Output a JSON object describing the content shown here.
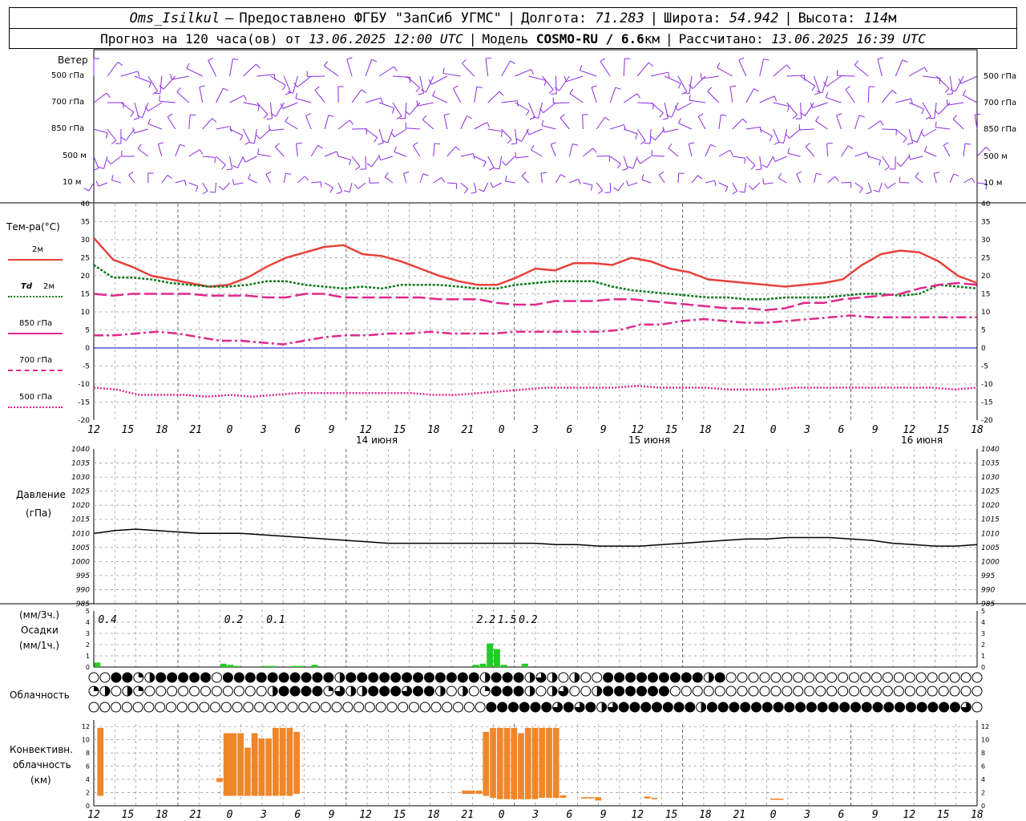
{
  "header": {
    "station": "Oms_Isilkul",
    "dash": "–",
    "provider": "Предоставлено ФГБУ \"ЗапСиб УГМС\"",
    "lon_label": "Долгота:",
    "lon_value": "71.283",
    "lat_label": "Широта:",
    "lat_value": "54.942",
    "alt_label": "Высота:",
    "alt_value": "114",
    "alt_unit": "м",
    "forecast_prefix": "Прогноз на 120 часа(ов) от",
    "forecast_time": "13.06.2025 12:00 UTC",
    "model_label": "Модель",
    "model_name": "COSMO-RU / 6.6",
    "model_unit": "км",
    "calc_label": "Рассчитано:",
    "calc_time": "13.06.2025 16:39 UTC"
  },
  "labels": {
    "wind_title": "Ветер",
    "wind_levels": [
      "500 гПа",
      "700 гПа",
      "850 гПа",
      "500 м",
      "10  м"
    ],
    "temp_title": "Тем-ра(°С)",
    "legend_2m": "2м",
    "legend_td": "Td",
    "legend_td_2m": "2м",
    "legend_850": "850 гПа",
    "legend_700": "700 гПа",
    "legend_500": "500 гПа",
    "pressure_title": "Давление",
    "pressure_unit": "(гПа)",
    "precip_unit3": "(мм/3ч.)",
    "precip_title": "Осадки",
    "precip_unit1": "(мм/1ч.)",
    "cloud_title": "Облачность",
    "conv_title1": "Конвективн.",
    "conv_title2": "облачность",
    "conv_unit": "(км)",
    "day_labels": [
      "14 июня",
      "15 июня",
      "16 июня"
    ]
  },
  "colors": {
    "wind": "#8a2be2",
    "t2m": "#e8413c",
    "td": "#0a7a1a",
    "t850": "#e0288c",
    "zero": "#0000cc",
    "pressure": "#000000",
    "precip": "#22cc22",
    "conv": "#f0862a",
    "grid": "#999999"
  },
  "chart_data": [
    {
      "type": "line",
      "name": "temperature",
      "x_hours": [
        0,
        3,
        6,
        9,
        12,
        15,
        18,
        21,
        24,
        27,
        30,
        33,
        36,
        39,
        42,
        45,
        48,
        51,
        54,
        57,
        60,
        63,
        66,
        69,
        72,
        75,
        78,
        81,
        84,
        87,
        90,
        93,
        96,
        99,
        102,
        105,
        108,
        111,
        114,
        117,
        120,
        123,
        126
      ],
      "x_tick_labels": [
        "12",
        "15",
        "18",
        "21",
        "0",
        "3",
        "6",
        "9",
        "12",
        "15",
        "18",
        "21",
        "0",
        "3",
        "6",
        "9",
        "12",
        "15",
        "18",
        "21",
        "0",
        "3",
        "6",
        "9",
        "12",
        "15",
        "18"
      ],
      "ylim": [
        -20,
        40
      ],
      "y_ticks": [
        -20,
        -15,
        -10,
        -5,
        0,
        5,
        10,
        15,
        20,
        25,
        30,
        35,
        40
      ],
      "series": [
        {
          "name": "2м",
          "key": "t2m",
          "values": [
            30.5,
            24.5,
            22.5,
            20,
            19,
            18,
            17,
            17.5,
            19.5,
            22.5,
            25,
            26.5,
            28,
            28.5,
            26,
            25.5,
            24,
            22,
            20,
            18.5,
            17.5,
            17.5,
            19.5,
            22,
            21.5,
            23.5,
            23.5,
            23,
            25,
            24,
            22,
            21,
            19,
            18.5,
            18,
            17.5,
            17,
            17.5,
            18,
            19,
            23,
            26,
            27,
            26.5,
            24,
            20,
            18
          ]
        },
        {
          "name": "Td 2м",
          "key": "td",
          "values": [
            23,
            19.5,
            19.5,
            19,
            18,
            17.5,
            17,
            17,
            17.5,
            18.5,
            18.5,
            17.5,
            17,
            16.5,
            17,
            16.5,
            17.5,
            17.5,
            17.5,
            17,
            16.5,
            16.5,
            17.5,
            18,
            18.5,
            18.5,
            18.5,
            17,
            16,
            15.5,
            15,
            14.5,
            14,
            14,
            13.5,
            13.5,
            14,
            14,
            14,
            14.5,
            15,
            15,
            14.5,
            15,
            17.5,
            17,
            16.5
          ]
        },
        {
          "name": "850 гПа",
          "key": "t850",
          "values": [
            15,
            14.5,
            15,
            15,
            15,
            15,
            14.5,
            14.5,
            14.5,
            14,
            14,
            15,
            15,
            14,
            14,
            14,
            14,
            14,
            13.5,
            13.5,
            13.5,
            12.5,
            12,
            12,
            13,
            13,
            13,
            13.5,
            13.5,
            13,
            12.5,
            12,
            11.5,
            11,
            11,
            10.5,
            11,
            12.5,
            12.5,
            13.5,
            14,
            14.5,
            15,
            16.5,
            17.5,
            18,
            17.5
          ]
        },
        {
          "name": "700 гПа",
          "key": "t700",
          "values": [
            3.5,
            3.5,
            4,
            4.5,
            4,
            3,
            2,
            2,
            1.5,
            1,
            2,
            3,
            3.5,
            3.5,
            4,
            4,
            4.5,
            4,
            4,
            4,
            4.5,
            4.5,
            4.5,
            4.5,
            4.5,
            5,
            6.5,
            6.5,
            7.5,
            8,
            7.5,
            7,
            7,
            7.5,
            8,
            8.5,
            9,
            8.5,
            8.5,
            8.5,
            8.5,
            8.5,
            8.5
          ]
        },
        {
          "name": "500 гПа",
          "key": "t500",
          "values": [
            -11,
            -11.5,
            -13,
            -13,
            -13,
            -13.5,
            -13,
            -13.5,
            -13,
            -12.5,
            -12.5,
            -12.5,
            -12.5,
            -12.5,
            -12.5,
            -13,
            -13,
            -12.5,
            -12,
            -11.5,
            -11,
            -11,
            -11,
            -11,
            -10.5,
            -11,
            -11,
            -11,
            -11.5,
            -11.5,
            -11.5,
            -11,
            -11,
            -11,
            -11,
            -11,
            -11,
            -11,
            -11.5,
            -11
          ]
        }
      ]
    },
    {
      "type": "line",
      "name": "pressure",
      "title": "Давление",
      "ylabel": "(гПа)",
      "ylim": [
        985,
        1040
      ],
      "y_ticks": [
        985,
        990,
        995,
        1000,
        1005,
        1010,
        1015,
        1020,
        1025,
        1030,
        1035,
        1040
      ],
      "x_hours": [
        0,
        3,
        6,
        9,
        12,
        15,
        18,
        21,
        24,
        27,
        30,
        33,
        36,
        39,
        42,
        45,
        48,
        51,
        54,
        57,
        60,
        63,
        66,
        69,
        72,
        75,
        78,
        81,
        84,
        87,
        90,
        93,
        96,
        99,
        102,
        105,
        108,
        111,
        114,
        117,
        120,
        123,
        126
      ],
      "values": [
        1010,
        1011,
        1011.5,
        1011,
        1010.5,
        1010,
        1010,
        1010,
        1009.5,
        1009,
        1008.5,
        1008,
        1007.5,
        1007,
        1006.5,
        1006.5,
        1006.5,
        1006.5,
        1006.5,
        1006.5,
        1006.5,
        1006.5,
        1006,
        1006,
        1005.5,
        1005.5,
        1005.5,
        1006,
        1006.5,
        1007,
        1007.5,
        1008,
        1008,
        1008.5,
        1008.5,
        1008.5,
        1008,
        1007.5,
        1006.5,
        1006,
        1005.5,
        1005.5,
        1006
      ]
    },
    {
      "type": "bar",
      "name": "precipitation",
      "title": "Осадки",
      "ylim": [
        0,
        5
      ],
      "y_ticks": [
        0,
        1,
        2,
        3,
        4,
        5
      ],
      "bars_1h": [
        {
          "h": 0.5,
          "v": 0.4
        },
        {
          "h": 18.5,
          "v": 0.3
        },
        {
          "h": 19.5,
          "v": 0.2
        },
        {
          "h": 20.5,
          "v": 0.1
        },
        {
          "h": 24.5,
          "v": 0.1
        },
        {
          "h": 25.5,
          "v": 0.1
        },
        {
          "h": 28.5,
          "v": 0.1
        },
        {
          "h": 29.5,
          "v": 0.1
        },
        {
          "h": 31.5,
          "v": 0.2
        },
        {
          "h": 54.5,
          "v": 0.2
        },
        {
          "h": 55.5,
          "v": 0.3
        },
        {
          "h": 56.5,
          "v": 2.1
        },
        {
          "h": 57.5,
          "v": 1.6
        },
        {
          "h": 58.5,
          "v": 0.2
        },
        {
          "h": 61.5,
          "v": 0.3
        }
      ],
      "totals_3h": [
        {
          "h": 1.5,
          "label": "0.4"
        },
        {
          "h": 19.5,
          "label": "0.2"
        },
        {
          "h": 25.5,
          "label": "0.1"
        },
        {
          "h": 55.5,
          "label": "2.2"
        },
        {
          "h": 58.5,
          "label": "1.5"
        },
        {
          "h": 61.5,
          "label": "0.2"
        }
      ]
    },
    {
      "type": "table",
      "name": "cloudiness",
      "title": "Облачность",
      "legend": "0 = clear, 1 = quarter, 2 = half, 3 = three-quarter, 4 = overcast",
      "rows": [
        [
          0,
          0,
          4,
          4,
          1,
          2,
          4,
          4,
          4,
          4,
          4,
          0,
          4,
          4,
          4,
          4,
          4,
          4,
          4,
          4,
          4,
          4,
          2,
          4,
          4,
          4,
          4,
          4,
          4,
          4,
          4,
          4,
          4,
          4,
          4,
          2,
          4,
          4,
          4,
          2,
          3,
          2,
          0,
          2,
          0,
          0,
          4,
          4,
          4,
          4,
          4,
          4,
          4,
          4,
          4,
          2,
          4,
          0,
          0,
          0,
          0,
          0,
          0,
          0,
          0,
          0,
          0,
          0,
          0,
          0,
          0,
          0,
          0,
          0,
          0,
          0,
          0,
          0,
          0,
          0
        ],
        [
          1,
          2,
          0,
          2,
          1,
          0,
          0,
          0,
          0,
          0,
          0,
          0,
          0,
          0,
          0,
          0,
          2,
          4,
          4,
          4,
          4,
          1,
          3,
          2,
          2,
          4,
          4,
          4,
          3,
          4,
          4,
          2,
          0,
          2,
          0,
          1,
          4,
          4,
          4,
          2,
          0,
          2,
          3,
          0,
          0,
          2,
          4,
          4,
          4,
          4,
          4,
          4,
          0,
          0,
          0,
          0,
          0,
          0,
          0,
          0,
          0,
          0,
          0,
          0,
          0,
          0,
          0,
          0,
          0,
          0,
          0,
          0,
          0,
          0,
          0,
          0,
          0,
          0,
          0,
          0
        ],
        [
          0,
          0,
          0,
          0,
          0,
          0,
          0,
          0,
          0,
          0,
          0,
          0,
          0,
          0,
          0,
          0,
          0,
          0,
          0,
          0,
          0,
          0,
          0,
          0,
          0,
          0,
          0,
          0,
          0,
          0,
          0,
          0,
          0,
          0,
          0,
          0,
          4,
          4,
          4,
          4,
          4,
          4,
          3,
          4,
          3,
          4,
          2,
          3,
          4,
          4,
          4,
          4,
          4,
          4,
          4,
          2,
          4,
          4,
          4,
          4,
          4,
          4,
          4,
          4,
          4,
          4,
          4,
          4,
          4,
          4,
          4,
          4,
          4,
          4,
          4,
          4,
          4,
          4,
          4,
          3,
          0
        ]
      ]
    },
    {
      "type": "bar",
      "name": "convective_cloud",
      "title": "Конвективн. облачность",
      "ylabel": "(км)",
      "ylim": [
        0,
        13
      ],
      "y_ticks": [
        0,
        2,
        4,
        6,
        8,
        10,
        12
      ],
      "segments": [
        {
          "h0": 0.5,
          "h1": 1.5,
          "base": 1.5,
          "top": 11.8
        },
        {
          "h0": 17.5,
          "h1": 18.5,
          "base": 3.6,
          "top": 4.2
        },
        {
          "h0": 18.5,
          "h1": 20.5,
          "base": 1.5,
          "top": 11
        },
        {
          "h0": 20.5,
          "h1": 21.5,
          "base": 1.5,
          "top": 11
        },
        {
          "h0": 21.5,
          "h1": 22.5,
          "base": 1.5,
          "top": 8.8
        },
        {
          "h0": 22.5,
          "h1": 23.5,
          "base": 1.5,
          "top": 11
        },
        {
          "h0": 23.5,
          "h1": 24.5,
          "base": 1.5,
          "top": 10.2
        },
        {
          "h0": 24.5,
          "h1": 25.5,
          "base": 1.5,
          "top": 10.2
        },
        {
          "h0": 25.5,
          "h1": 26.5,
          "base": 1.5,
          "top": 11.8
        },
        {
          "h0": 26.5,
          "h1": 27.5,
          "base": 1.5,
          "top": 11.8
        },
        {
          "h0": 27.5,
          "h1": 28.5,
          "base": 1.5,
          "top": 11.8
        },
        {
          "h0": 28.5,
          "h1": 29.5,
          "base": 1.8,
          "top": 11.2
        },
        {
          "h0": 52.5,
          "h1": 54.5,
          "base": 1.8,
          "top": 2.3
        },
        {
          "h0": 54.5,
          "h1": 55.5,
          "base": 1.8,
          "top": 2.3
        },
        {
          "h0": 55.5,
          "h1": 56.5,
          "base": 1.5,
          "top": 11.2
        },
        {
          "h0": 56.5,
          "h1": 57.5,
          "base": 1.2,
          "top": 11.8
        },
        {
          "h0": 57.5,
          "h1": 58.5,
          "base": 1,
          "top": 11.8
        },
        {
          "h0": 58.5,
          "h1": 59.5,
          "base": 1,
          "top": 11.8
        },
        {
          "h0": 59.5,
          "h1": 60.5,
          "base": 1,
          "top": 11.8
        },
        {
          "h0": 60.5,
          "h1": 61.5,
          "base": 1,
          "top": 11
        },
        {
          "h0": 61.5,
          "h1": 62.5,
          "base": 1,
          "top": 11.8
        },
        {
          "h0": 62.5,
          "h1": 63.5,
          "base": 1,
          "top": 11.8
        },
        {
          "h0": 63.5,
          "h1": 64.5,
          "base": 1.2,
          "top": 11.8
        },
        {
          "h0": 64.5,
          "h1": 65.5,
          "base": 1.2,
          "top": 11.8
        },
        {
          "h0": 65.5,
          "h1": 66.5,
          "base": 1.2,
          "top": 11.8
        },
        {
          "h0": 66.5,
          "h1": 67.5,
          "base": 1.2,
          "top": 1.6
        },
        {
          "h0": 69.5,
          "h1": 71.5,
          "base": 1.1,
          "top": 1.3
        },
        {
          "h0": 71.5,
          "h1": 72.5,
          "base": 0.8,
          "top": 1.3
        },
        {
          "h0": 78.5,
          "h1": 79.5,
          "base": 1.1,
          "top": 1.4
        },
        {
          "h0": 79.5,
          "h1": 80.5,
          "base": 1,
          "top": 1.2
        },
        {
          "h0": 96.5,
          "h1": 98.5,
          "base": 0.9,
          "top": 1.1
        }
      ]
    }
  ]
}
